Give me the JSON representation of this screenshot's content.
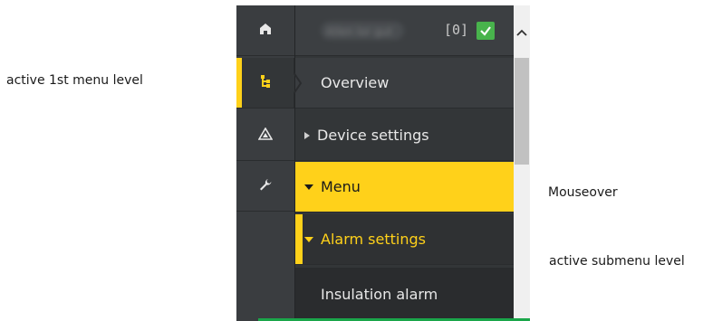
{
  "annotations": {
    "active_first_level": "active 1st menu level",
    "mouseover": "Mouseover",
    "active_submenu": "active submenu level"
  },
  "rail": {
    "items": [
      {
        "icon": "home-icon",
        "active": false
      },
      {
        "icon": "tree-icon",
        "active": true
      },
      {
        "icon": "warning-icon",
        "active": false
      },
      {
        "icon": "wrench-icon",
        "active": false
      }
    ]
  },
  "header": {
    "device_name": "Allen lor gut",
    "count": "[0]",
    "status": "ok"
  },
  "menu": {
    "overview": "Overview",
    "device_settings": "Device settings",
    "menu": "Menu",
    "alarm_settings": "Alarm settings",
    "insulation_alarm": "Insulation alarm"
  },
  "colors": {
    "accent": "#ffd11a",
    "panel": "#333638",
    "status_ok": "#48b34c"
  }
}
